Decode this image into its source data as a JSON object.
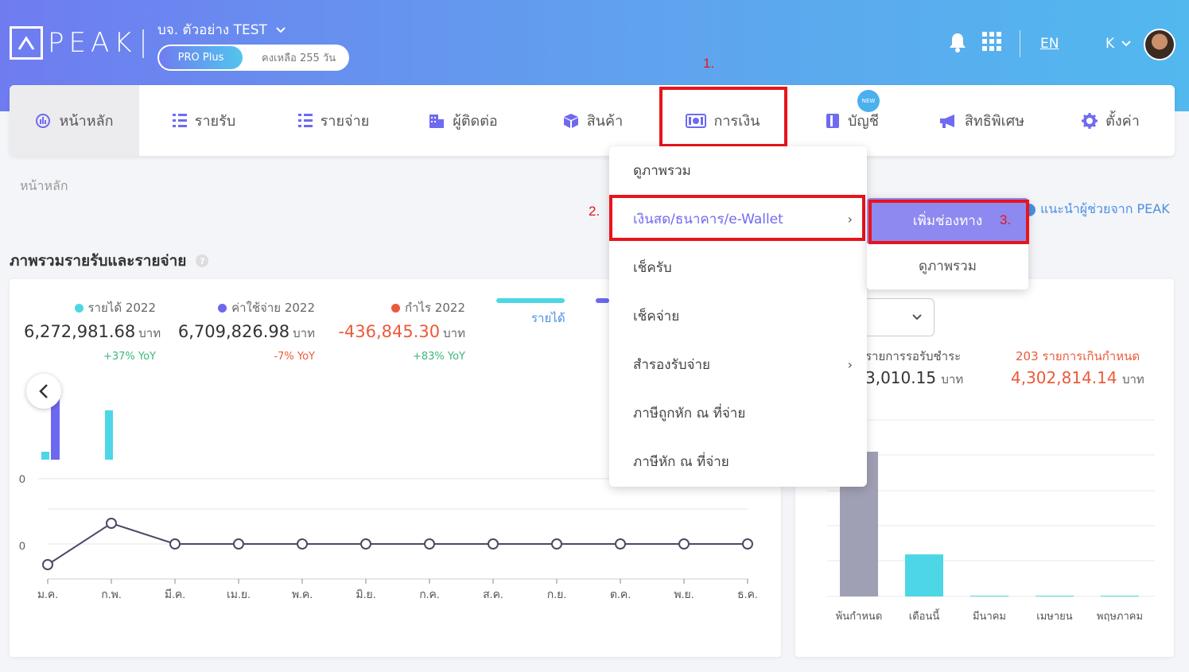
{
  "header": {
    "logo_text": "PEAK",
    "company_name": "บจ. ตัวอย่าง TEST",
    "plan_name": "PRO Plus",
    "plan_remaining": "คงเหลือ 255 วัน",
    "language": "EN",
    "user_initial": "K",
    "icons": [
      "bell-icon",
      "apps-grid-icon",
      "chevron-down-icon"
    ]
  },
  "nav": {
    "items": [
      {
        "label": "หน้าหลัก",
        "icon": "dashboard-icon"
      },
      {
        "label": "รายรับ",
        "icon": "income-list-icon"
      },
      {
        "label": "รายจ่าย",
        "icon": "expense-list-icon"
      },
      {
        "label": "ผู้ติดต่อ",
        "icon": "contacts-building-icon"
      },
      {
        "label": "สินค้า",
        "icon": "box-icon"
      },
      {
        "label": "การเงิน",
        "icon": "money-icon"
      },
      {
        "label": "บัญชี",
        "icon": "book-icon",
        "badge": "NEW"
      },
      {
        "label": "สิทธิพิเศษ",
        "icon": "megaphone-icon"
      },
      {
        "label": "ตั้งค่า",
        "icon": "gear-icon"
      }
    ]
  },
  "annotations": {
    "step1": "1.",
    "step2": "2.",
    "step3": "3."
  },
  "breadcrumb": "หน้าหลัก",
  "help_link": "แนะนำผู้ช่วยจาก PEAK",
  "section_title": "ภาพรวมรายรับและรายจ่าย",
  "summary": {
    "income": {
      "label": "รายได้ 2022",
      "value": "6,272,981.68",
      "unit": "บาท",
      "yoy": "+37% YoY",
      "color": "#4dd6e6",
      "yoy_color": "#3cb878"
    },
    "expense": {
      "label": "ค่าใช้จ่าย 2022",
      "value": "6,709,826.98",
      "unit": "บาท",
      "yoy": "-7% YoY",
      "color": "#6c68f0",
      "yoy_color": "#ec5a3a"
    },
    "profit": {
      "label": "กำไร 2022",
      "value": "-436,845.30",
      "unit": "บาท",
      "yoy": "+83% YoY",
      "color": "#ec5a3a",
      "yoy_color": "#3cb878"
    },
    "legend_income": "รายได้"
  },
  "chart_data": [
    {
      "type": "line",
      "categories": [
        "ม.ค.",
        "ก.พ.",
        "มี.ค.",
        "เม.ย.",
        "พ.ค.",
        "มิ.ย.",
        "ก.ค.",
        "ส.ค.",
        "ก.ย.",
        "ต.ค.",
        "พ.ย.",
        "ธ.ค."
      ],
      "values": [
        -1,
        1,
        0,
        0,
        0,
        0,
        0,
        0,
        0,
        0,
        0,
        0
      ],
      "y_tick": "0",
      "upper_y_tick": "0"
    },
    {
      "type": "bar",
      "categories": [
        "พ้นกำหนด",
        "เดือนนี้",
        "มีนาคม",
        "เมษายน",
        "พฤษภาคม"
      ],
      "values": [
        4302814.14,
        1250000,
        0,
        0,
        0
      ],
      "colors": [
        "#9fa0b4",
        "#4dd6e6",
        "#4dd6e6",
        "#4dd6e6",
        "#4dd6e6"
      ]
    }
  ],
  "receivables": {
    "pending_label": "รายการรอรับชำระ",
    "pending_value": "3,010.15",
    "overdue_label": "203 รายการเกินกำหนด",
    "overdue_value": "4,302,814.14",
    "unit": "บาท"
  },
  "finance_menu": {
    "items": [
      {
        "label": "ดูภาพรวม",
        "has_sub": false
      },
      {
        "label": "เงินสด/ธนาคาร/e-Wallet",
        "has_sub": true
      },
      {
        "label": "เช็ครับ",
        "has_sub": false
      },
      {
        "label": "เช็คจ่าย",
        "has_sub": false
      },
      {
        "label": "สำรองรับจ่าย",
        "has_sub": true
      },
      {
        "label": "ภาษีถูกหัก ณ ที่จ่าย",
        "has_sub": false
      },
      {
        "label": "ภาษีหัก ณ ที่จ่าย",
        "has_sub": false
      }
    ]
  },
  "cash_submenu": {
    "items": [
      "เพิ่มช่องทาง",
      "ดูภาพรวม"
    ]
  }
}
